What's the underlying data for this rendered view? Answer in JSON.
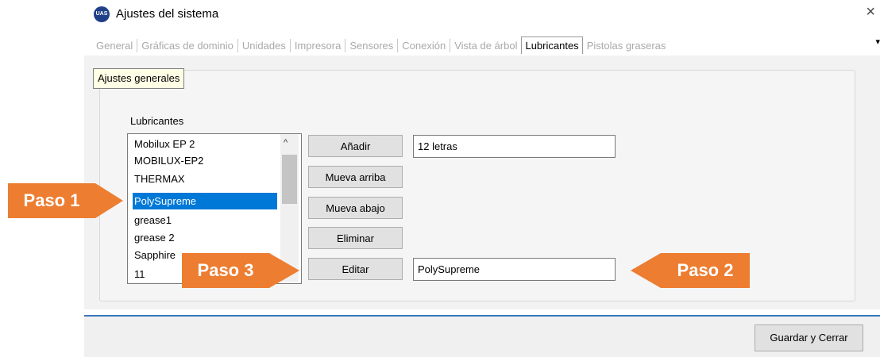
{
  "window": {
    "title": "Ajustes del sistema",
    "icon_text": "UAS",
    "close_glyph": "×"
  },
  "tabs": [
    {
      "label": "General"
    },
    {
      "label": "Gráficas de dominio"
    },
    {
      "label": "Unidades"
    },
    {
      "label": "Impresora"
    },
    {
      "label": "Sensores"
    },
    {
      "label": "Conexión"
    },
    {
      "label": "Vista de árbol"
    },
    {
      "label": "Lubricantes",
      "active": true
    },
    {
      "label": "Pistolas graseras"
    }
  ],
  "tab_scroll_glyph": "▾",
  "group": {
    "title": "Ajustes generales"
  },
  "lubricants": {
    "label": "Lubricantes",
    "items": [
      "Mobilux EP 2",
      "MOBILUX-EP2",
      "THERMAX",
      "PolySupreme",
      "grease1",
      "grease 2",
      "Sapphire",
      "11"
    ],
    "selected_index": 3,
    "scroll_up_glyph": "^"
  },
  "buttons": {
    "add": "Añadir",
    "move_up": "Mueva arriba",
    "move_down": "Mueva abajo",
    "delete": "Eliminar",
    "edit": "Editar"
  },
  "fields": {
    "new_name_value": "12 letras",
    "edit_name_value": "PolySupreme"
  },
  "footer": {
    "save_close": "Guardar y Cerrar"
  },
  "callouts": {
    "step1": "Paso 1",
    "step2": "Paso 2",
    "step3": "Paso 3",
    "color": "#ed7d31"
  },
  "colors": {
    "selection": "#0078d7",
    "footer_line": "#3b78b8",
    "group_title_bg": "#ffffe6"
  }
}
